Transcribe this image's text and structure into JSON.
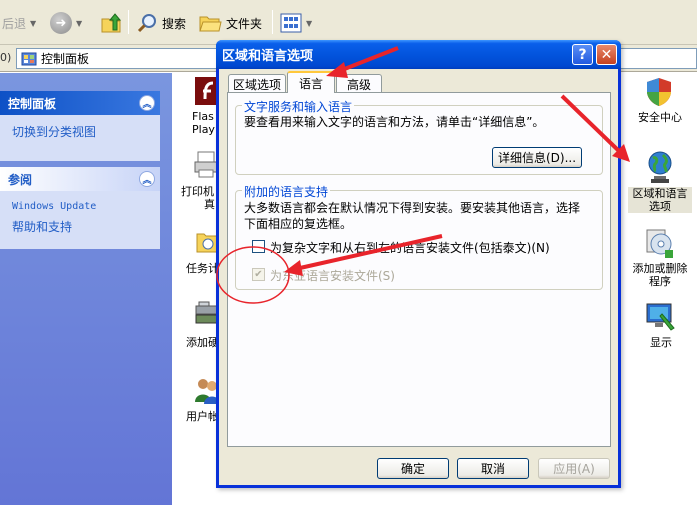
{
  "toolbar": {
    "back_label": "后退",
    "search_label": "搜索",
    "folders_label": "文件夹"
  },
  "address": {
    "cut_label": "0)",
    "value": "控制面板"
  },
  "taskpane": {
    "control_panel_header": "控制面板",
    "switch_view_link": "切换到分类视图",
    "see_also_header": "参阅",
    "windows_update_link": "Windows Update",
    "help_link": "帮助和支持"
  },
  "cp_items": {
    "flash_line1": "Flas",
    "flash_line2": "Play",
    "printers_line1": "打印机",
    "printers_line2": "真",
    "tasks": "任务计",
    "add_hw": "添加硬",
    "user_accounts": "用户帐",
    "security_center": "安全中心",
    "regional_line1": "区域和语言",
    "regional_line2": "选项",
    "add_remove_line1": "添加或删除",
    "add_remove_line2": "程序",
    "display": "显示"
  },
  "dialog": {
    "title": "区域和语言选项",
    "help_glyph": "?",
    "close_glyph": "✕",
    "tabs": [
      "区域选项",
      "语言",
      "高级"
    ],
    "group1_title": "文字服务和输入语言",
    "group1_text": "要查看用来输入文字的语言和方法，请单击“详细信息”。",
    "details_button": "详细信息(D)...",
    "group2_title": "附加的语言支持",
    "group2_text_line1": "大多数语言都会在默认情况下得到安装。要安装其他语言，选择",
    "group2_text_line2": "下面相应的复选框。",
    "complex_script_label": "为复杂文字和从右到左的语言安装文件(包括泰文)(N)",
    "east_asian_label": "为东亚语言安装文件(S)",
    "ok_button": "确定",
    "cancel_button": "取消",
    "apply_button": "应用(A)"
  },
  "state": {
    "complex_script_checked": false,
    "east_asian_checked": true,
    "east_asian_disabled": true
  },
  "colors": {
    "annotation_red": "#e8242b",
    "xp_title_blue": "#0a5fea",
    "taskpane_blue": "#6375d6"
  }
}
